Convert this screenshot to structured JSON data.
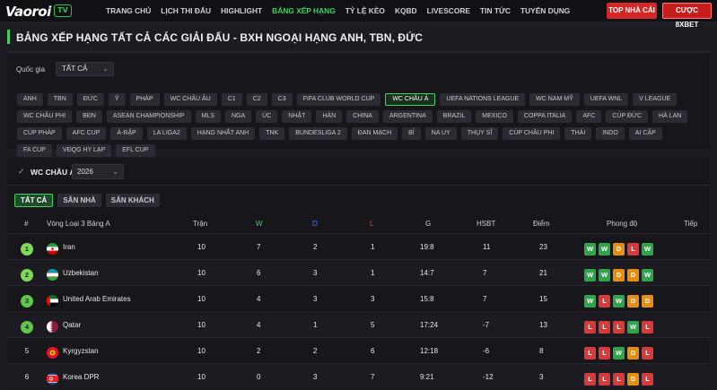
{
  "logo": {
    "text": "Vaoroi",
    "badge": "TV"
  },
  "nav": [
    "TRANG CHỦ",
    "LỊCH THI ĐẤU",
    "HIGHLIGHT",
    "BẢNG XẾP HẠNG",
    "TỶ LỆ KÈO",
    "KQBD",
    "LIVESCORE",
    "TIN TỨC",
    "TUYỂN DỤNG"
  ],
  "nav_active_index": 3,
  "buttons": {
    "top_nha_cai": "TOP NHÀ CÁI",
    "cuoc_8xbet": "CƯỢC 8XBET"
  },
  "page_title": "BẢNG XẾP HẠNG TẤT CẢ CÁC GIẢI ĐẤU - BXH NGOẠI HẠNG ANH, TBN, ĐỨC",
  "filter": {
    "country_label": "Quốc gia",
    "country_value": "TẤT CẢ",
    "chips": [
      "ANH",
      "TBN",
      "ĐỨC",
      "Ý",
      "PHÁP",
      "WC CHÂU ÂU",
      "C1",
      "C2",
      "C3",
      "FIFA CLUB WORLD CUP",
      "WC CHÂU Á",
      "UEFA NATIONS LEAGUE",
      "WC NAM MỸ",
      "UEFA WNL",
      "V LEAGUE",
      "WC CHÂU PHI",
      "BĐN",
      "ASEAN CHAMPIONSHIP",
      "MLS",
      "NGA",
      "ÚC",
      "NHẬT",
      "HÀN",
      "CHINA",
      "ARGENTINA",
      "BRAZIL",
      "MEXICO",
      "COPPA ITALIA",
      "AFC",
      "CÚP ĐỨC",
      "HÀ LAN",
      "CÚP PHÁP",
      "AFC CUP",
      "Ả-RẬP",
      "LA LIGA2",
      "HẠNG NHẤT ANH",
      "TNK",
      "BUNDESLIGA 2",
      "ĐAN MẠCH",
      "BỈ",
      "NA UY",
      "THỤY SĨ",
      "CÚP CHÂU PHI",
      "THÁI",
      "INDO",
      "AI CẬP",
      "FA CUP",
      "VĐQG HY LẠP",
      "EFL CUP"
    ],
    "active_chip": "WC CHÂU Á"
  },
  "section": {
    "title": "WC CHÂU Á",
    "season": "2026",
    "tabs": [
      "TẤT CẢ",
      "SÂN NHÀ",
      "SÂN KHÁCH"
    ],
    "active_tab": 0
  },
  "table": {
    "headers": {
      "rank": "#",
      "group": "Vòng Loại 3 Bảng A",
      "played": "Trận",
      "w": "W",
      "d": "D",
      "l": "L",
      "g": "G",
      "gd": "HSBT",
      "pts": "Điểm",
      "form": "Phong độ",
      "next": "Tiếp"
    },
    "header_colors": {
      "w": "#3ed161",
      "d": "#3b82f6",
      "l": "#e04848"
    },
    "rows": [
      {
        "rank": "1",
        "team": "Iran",
        "played": "10",
        "w": "7",
        "d": "2",
        "l": "1",
        "g": "19:8",
        "gd": "11",
        "pts": "23",
        "form": [
          "W",
          "W",
          "D",
          "L",
          "W"
        ],
        "badge_color": "#7ed957",
        "flag": "iran"
      },
      {
        "rank": "2",
        "team": "Uzbekistan",
        "played": "10",
        "w": "6",
        "d": "3",
        "l": "1",
        "g": "14:7",
        "gd": "7",
        "pts": "21",
        "form": [
          "W",
          "W",
          "D",
          "D",
          "W"
        ],
        "badge_color": "#7ed957",
        "flag": "uzbekistan"
      },
      {
        "rank": "3",
        "team": "United Arab Emirates",
        "played": "10",
        "w": "4",
        "d": "3",
        "l": "3",
        "g": "15:8",
        "gd": "7",
        "pts": "15",
        "form": [
          "W",
          "L",
          "W",
          "D",
          "D"
        ],
        "badge_color": "#5fc64a",
        "flag": "uae"
      },
      {
        "rank": "4",
        "team": "Qatar",
        "played": "10",
        "w": "4",
        "d": "1",
        "l": "5",
        "g": "17:24",
        "gd": "-7",
        "pts": "13",
        "form": [
          "L",
          "L",
          "L",
          "W",
          "L"
        ],
        "badge_color": "#5fc64a",
        "flag": "qatar"
      },
      {
        "rank": "5",
        "team": "Kyrgyzstan",
        "played": "10",
        "w": "2",
        "d": "2",
        "l": "6",
        "g": "12:18",
        "gd": "-6",
        "pts": "8",
        "form": [
          "L",
          "L",
          "W",
          "D",
          "L"
        ],
        "badge_color": "",
        "flag": "kyrgyzstan"
      },
      {
        "rank": "6",
        "team": "Korea DPR",
        "played": "10",
        "w": "0",
        "d": "3",
        "l": "7",
        "g": "9:21",
        "gd": "-12",
        "pts": "3",
        "form": [
          "L",
          "L",
          "L",
          "D",
          "L"
        ],
        "badge_color": "",
        "flag": "korea-dpr"
      }
    ]
  }
}
